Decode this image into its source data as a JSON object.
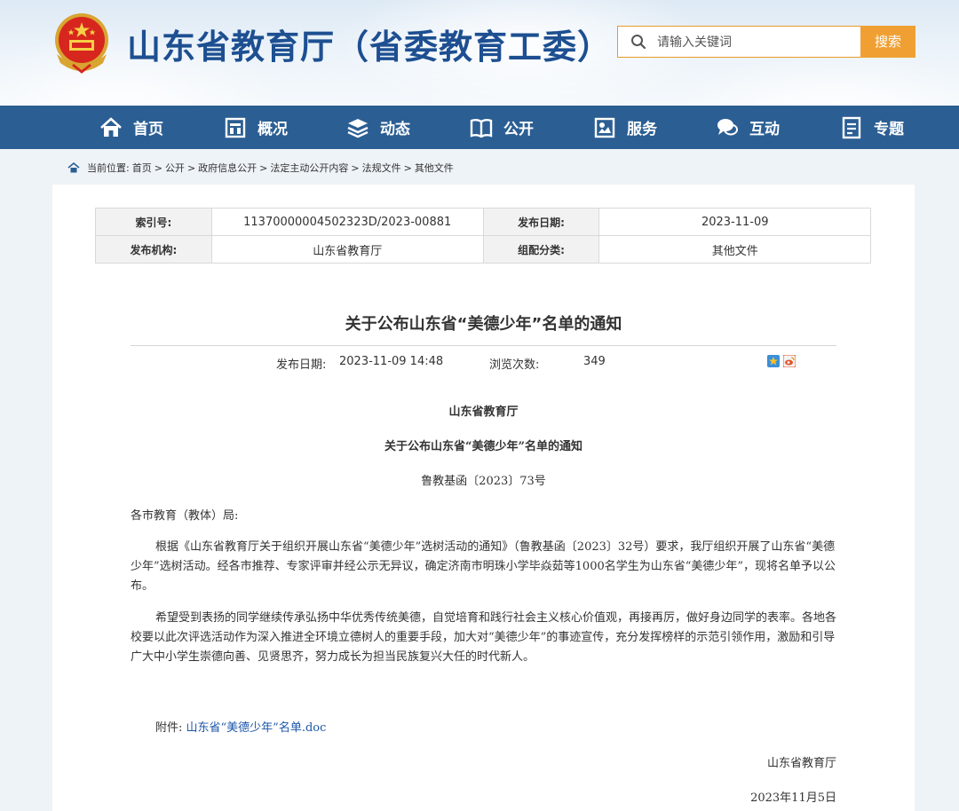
{
  "header": {
    "site_title": "山东省教育厅（省委教育工委）",
    "search_placeholder": "请输入关键词",
    "search_button": "搜索"
  },
  "nav": {
    "items": [
      {
        "label": "首页",
        "icon": "home-icon"
      },
      {
        "label": "概况",
        "icon": "building-icon"
      },
      {
        "label": "动态",
        "icon": "layers-icon"
      },
      {
        "label": "公开",
        "icon": "book-icon"
      },
      {
        "label": "服务",
        "icon": "service-icon"
      },
      {
        "label": "互动",
        "icon": "chat-icon"
      },
      {
        "label": "专题",
        "icon": "document-icon"
      }
    ]
  },
  "breadcrumb": {
    "prefix": "当前位置:",
    "items": [
      "首页",
      "公开",
      "政府信息公开",
      "法定主动公开内容",
      "法规文件",
      "其他文件"
    ],
    "separator": ">"
  },
  "meta": {
    "index_label": "索引号:",
    "index_value": "11370000004502323D/2023-00881",
    "date_label": "发布日期:",
    "date_value": "2023-11-09",
    "org_label": "发布机构:",
    "org_value": "山东省教育厅",
    "category_label": "组配分类:",
    "category_value": "其他文件"
  },
  "article": {
    "title": "关于公布山东省“美德少年”名单的通知",
    "publish_label": "发布日期:",
    "publish_value": "2023-11-09 14:48",
    "views_label": "浏览次数:",
    "views_value": "349",
    "issuer": "山东省教育厅",
    "subtitle": "关于公布山东省“美德少年”名单的通知",
    "doc_number": "鲁教基函〔2023〕73号",
    "salutation": "各市教育（教体）局:",
    "para1": "根据《山东省教育厅关于组织开展山东省“美德少年”选树活动的通知》（鲁教基函〔2023〕32号）要求，我厅组织开展了山东省“美德少年”选树活动。经各市推荐、专家评审并经公示无异议，确定济南市明珠小学毕焱茹等1000名学生为山东省“美德少年”，现将名单予以公布。",
    "para2": "希望受到表扬的同学继续传承弘扬中华优秀传统美德，自觉培育和践行社会主义核心价值观，再接再厉，做好身边同学的表率。各地各校要以此次评选活动作为深入推进全环境立德树人的重要手段，加大对“美德少年”的事迹宣传，充分发挥榜样的示范引领作用，激励和引导广大中小学生崇德向善、见贤思齐，努力成长为担当民族复兴大任的时代新人。",
    "attachment_label": "附件:",
    "attachment_link": "山东省“美德少年”名单.doc",
    "sign_org": "山东省教育厅",
    "sign_date": "2023年11月5日"
  },
  "colors": {
    "nav_bg": "#2b5e93",
    "title_blue": "#1d4f91",
    "search_orange": "#f0a033",
    "link_blue": "#1d56a8"
  }
}
